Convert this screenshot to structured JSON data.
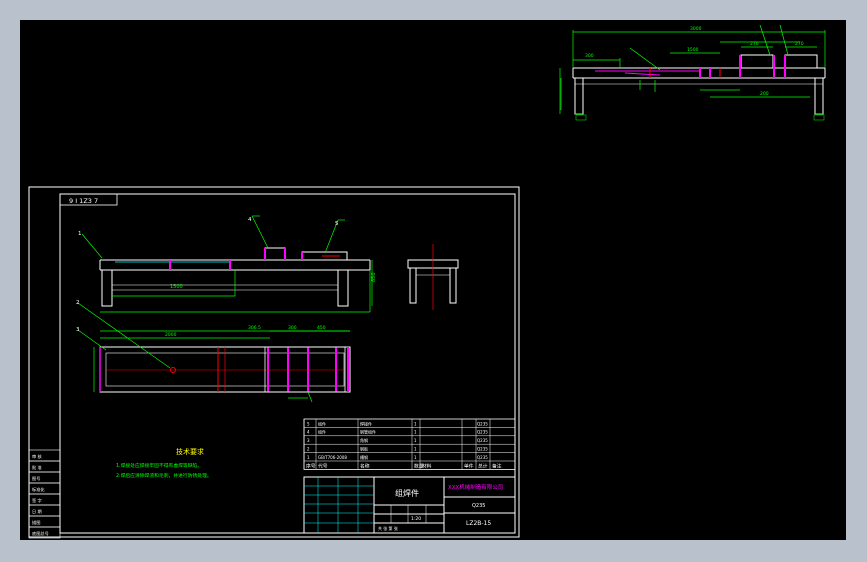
{
  "sheet": {
    "view_tag": "9 I 1Z3 7",
    "tech_title": "技术要求",
    "tech_notes": [
      "1.焊接处应焊接牢固不得有虚焊等缺陷。",
      "2.焊后应清除焊渣和毛刺，并进行防锈处理。"
    ]
  },
  "left_strip": [
    "审 核",
    "批 准",
    "图号",
    "标准化",
    "签 字",
    "日 期",
    "描图",
    "底图总号"
  ],
  "dims_top_right": {
    "overall": "3000",
    "d1": "300",
    "d2": "1500",
    "d3": "270",
    "d4": "270",
    "d5": "200"
  },
  "dims_main": {
    "height": "850",
    "width": "1500",
    "left": "306.5",
    "right": "300",
    "plan": "2000",
    "span": "450"
  },
  "balloons": [
    "1",
    "2",
    "3",
    "4",
    "5"
  ],
  "bom": {
    "rows": [
      {
        "no": "5",
        "code": "组件",
        "name": "焊接件",
        "qty": "1",
        "mat": "",
        "mass": "Q235"
      },
      {
        "no": "4",
        "code": "组件",
        "name": "钢管组件",
        "qty": "1",
        "mat": "",
        "mass": "Q235"
      },
      {
        "no": "3",
        "code": "",
        "name": "角钢",
        "qty": "1",
        "mat": "",
        "mass": "Q235"
      },
      {
        "no": "2",
        "code": "",
        "name": "钢板",
        "qty": "1",
        "mat": "",
        "mass": "Q235"
      },
      {
        "no": "1",
        "code": "GB/T706-2008",
        "name": "槽钢",
        "qty": "1",
        "mat": "",
        "mass": "Q235"
      }
    ],
    "headers": [
      "序号",
      "代号",
      "名称",
      "数量",
      "材料",
      "单件",
      "总计",
      "备注"
    ]
  },
  "title_block": {
    "part_name": "组焊件",
    "company": "XXX机械制造有限公司",
    "drawing_no": "LZ2B-15",
    "scale": "1:20",
    "material": "Q235",
    "label_sheet": "共 张 第 张"
  },
  "colors": {
    "line": "#ffffff",
    "dim": "#00ff00",
    "accent": "#ff00ff",
    "red": "#ff0000",
    "cyan": "#00ffff",
    "yellow": "#ffff00"
  }
}
